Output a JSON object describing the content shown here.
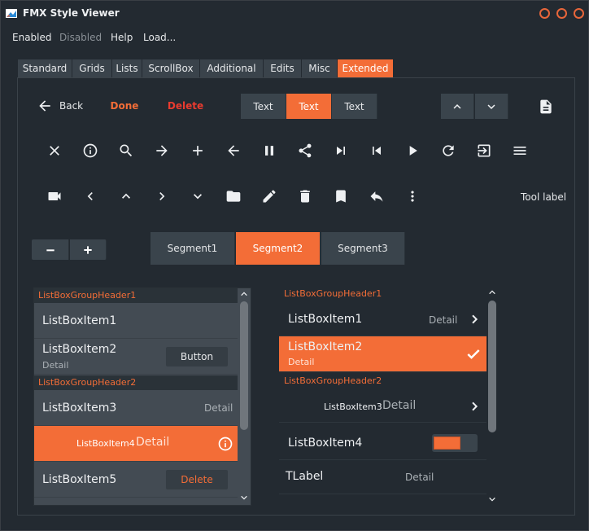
{
  "window": {
    "title": "FMX Style Viewer",
    "accent": "#f36d37"
  },
  "menu": {
    "enabled": "Enabled",
    "disabled": "Disabled",
    "help": "Help",
    "load": "Load..."
  },
  "tabs": [
    {
      "label": "Standard",
      "active": false
    },
    {
      "label": "Grids",
      "active": false
    },
    {
      "label": "Lists",
      "active": false
    },
    {
      "label": "ScrollBox",
      "active": false
    },
    {
      "label": "Additional",
      "active": false
    },
    {
      "label": "Edits",
      "active": false
    },
    {
      "label": "Misc",
      "active": false
    },
    {
      "label": "Extended",
      "active": true
    }
  ],
  "toolbar": {
    "back_label": "Back",
    "done_label": "Done",
    "delete_label": "Delete",
    "segments": [
      "Text",
      "Text",
      "Text"
    ],
    "active_segment": 1,
    "tool_label": "Tool label"
  },
  "icon_rows": {
    "row1": [
      "close-icon",
      "info-icon",
      "search-icon",
      "arrow-right-icon",
      "plus-icon",
      "arrow-left-icon",
      "pause-icon",
      "share-icon",
      "skip-next-icon",
      "skip-previous-icon",
      "play-icon",
      "refresh-icon",
      "exit-icon",
      "menu-icon"
    ],
    "row2": [
      "camera-icon",
      "chevron-left-icon",
      "chevron-up-icon",
      "chevron-right-icon",
      "chevron-down-icon",
      "folder-icon",
      "pencil-icon",
      "trash-icon",
      "bookmark-icon",
      "reply-icon",
      "more-vertical-icon"
    ]
  },
  "segments": {
    "items": [
      "Segment1",
      "Segment2",
      "Segment3"
    ],
    "active": 1
  },
  "left_list": {
    "header1": "ListBoxGroupHeader1",
    "header2": "ListBoxGroupHeader2",
    "item1": "ListBoxItem1",
    "item2": "ListBoxItem2",
    "item2_sub": "Detail",
    "item2_button": "Button",
    "item3": "ListBoxItem3",
    "item3_detail": "Detail",
    "item4": "ListBoxItem4",
    "item4_detail": "Detail",
    "item5": "ListBoxItem5",
    "item5_button": "Delete"
  },
  "right_list": {
    "header1": "ListBoxGroupHeader1",
    "header2": "ListBoxGroupHeader2",
    "item1": "ListBoxItem1",
    "item1_detail": "Detail",
    "item2": "ListBoxItem2",
    "item2_sub": "Detail",
    "item3": "ListBoxItem3",
    "item3_detail": "Detail",
    "item4": "ListBoxItem4",
    "item5": "TLabel",
    "item5_detail": "Detail"
  }
}
